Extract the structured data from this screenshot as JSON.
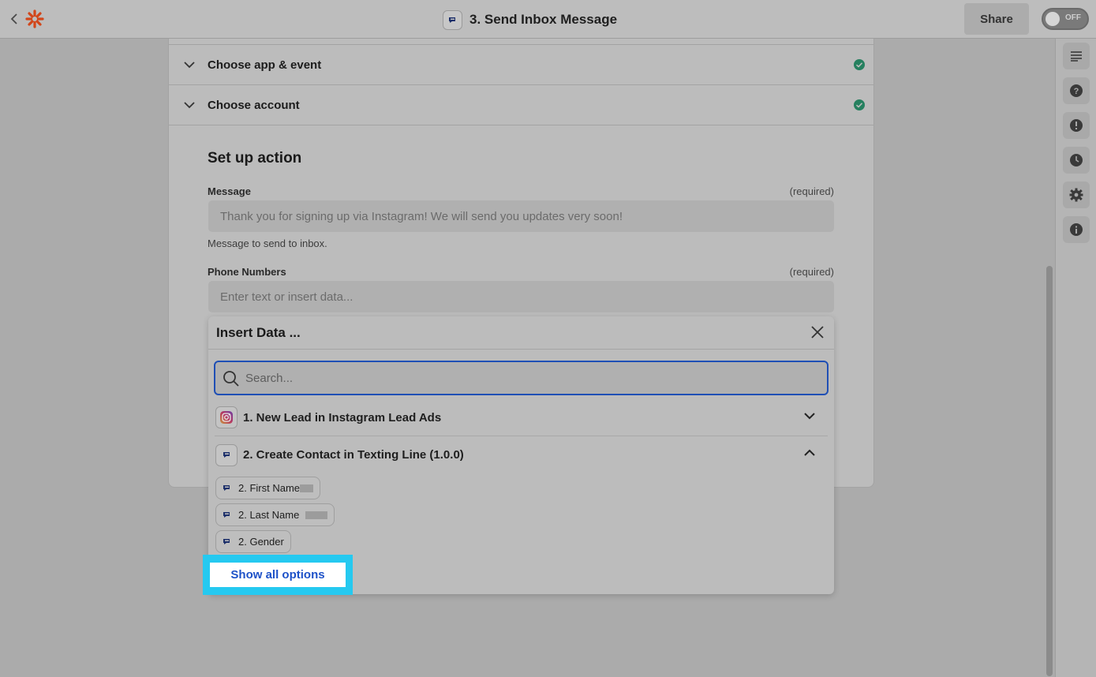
{
  "topbar": {
    "title": "3. Send Inbox Message",
    "share_label": "Share",
    "toggle_label": "OFF"
  },
  "accordion": [
    {
      "label": "Choose app & event"
    },
    {
      "label": "Choose account"
    }
  ],
  "setup": {
    "section_title": "Set up action",
    "message": {
      "label": "Message",
      "required": "(required)",
      "value": "Thank you for signing up via Instagram! We will send you updates very soon!",
      "help": "Message to send to inbox."
    },
    "phone": {
      "label": "Phone Numbers",
      "required": "(required)",
      "placeholder": "Enter text or insert data..."
    }
  },
  "insert_data": {
    "title": "Insert Data ...",
    "search_placeholder": "Search...",
    "steps": [
      {
        "label": "1. New Lead in Instagram Lead Ads",
        "expanded": false
      },
      {
        "label": "2. Create Contact in Texting Line (1.0.0)",
        "expanded": true
      }
    ],
    "fields": [
      {
        "label": "2. First Name"
      },
      {
        "label": "2. Last Name"
      },
      {
        "label": "2. Gender"
      }
    ],
    "show_all_label": "Show all options"
  },
  "colors": {
    "accent_blue": "#1e52c8",
    "highlight_cyan": "#25c9f0",
    "check_green": "#25805f",
    "zapier_orange": "#e8571e"
  },
  "icons": {
    "back": "chevron-left-icon",
    "logo": "zapier-logo-icon",
    "rail": [
      "outline-icon",
      "help-icon",
      "alert-icon",
      "history-icon",
      "settings-icon",
      "info-icon"
    ]
  }
}
